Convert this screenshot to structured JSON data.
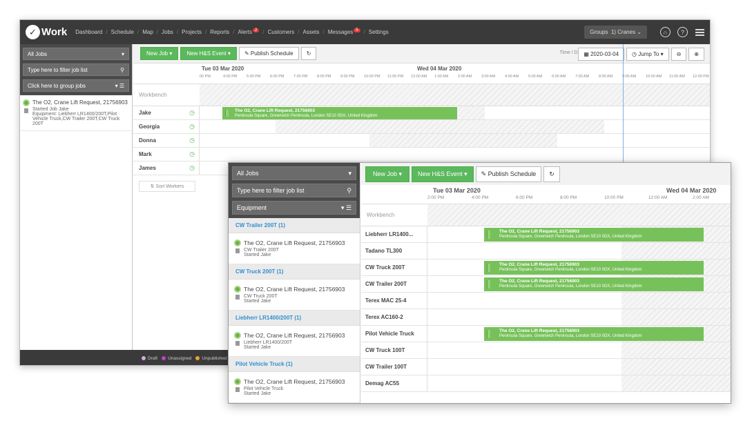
{
  "back": {
    "logo": "Work",
    "nav": [
      {
        "label": "Dashboard"
      },
      {
        "label": "Schedule"
      },
      {
        "label": "Map"
      },
      {
        "label": "Jobs"
      },
      {
        "label": "Projects"
      },
      {
        "label": "Reports"
      },
      {
        "label": "Alerts",
        "badge": "2"
      },
      {
        "label": "Customers"
      },
      {
        "label": "Assets"
      },
      {
        "label": "Messages",
        "badge": "5"
      },
      {
        "label": "Settings"
      }
    ],
    "groups_label": "Groups",
    "groups_value": "1) Cranes",
    "sidebar": {
      "filter_select": "All Jobs",
      "search_placeholder": "Type here to filter job list",
      "group_select": "Click here to group jobs",
      "job": {
        "title": "The O2, Crane Lift Request, 21756903",
        "status": "Started Job Jake",
        "equipment": "Equipment: Liebherr LR1400/200T,Pilot Vehicle Truck,CW Trailer 200T,CW Truck 200T"
      }
    },
    "toolbar": {
      "new_job": "New Job",
      "new_hs": "New H&S Event",
      "publish": "Publish Schedule",
      "range_label": "Time / Date Range",
      "date": "2020-03-04",
      "jump": "Jump To"
    },
    "dates": [
      "Tue 03 Mar 2020",
      "Wed 04 Mar 2020"
    ],
    "times": [
      "00 PM",
      "4:00 PM",
      "5:00 PM",
      "6:00 PM",
      "7:00 PM",
      "8:00 PM",
      "9:00 PM",
      "10:00 PM",
      "11:00 PM",
      "12:00 AM",
      "1:00 AM",
      "2:00 AM",
      "3:00 AM",
      "4:00 AM",
      "5:00 AM",
      "6:00 AM",
      "7:00 AM",
      "8:00 AM",
      "9:00 AM",
      "10:00 AM",
      "11:00 AM",
      "12:00 PM"
    ],
    "workbench": "Workbench",
    "workers": [
      "Jake",
      "Georgia",
      "Donna",
      "Mark",
      "James"
    ],
    "event": {
      "title": "The O2, Crane Lift Request, 21756903",
      "address": "Peninsula Square, Greenwich Peninsula, London SE10 0DX, United Kingdom"
    },
    "sort_workers": "Sort Workers",
    "legend": [
      {
        "label": "Draft",
        "color": "#d9a7e0"
      },
      {
        "label": "Unassigned",
        "color": "#c23fd0"
      },
      {
        "label": "Unpublished",
        "color": "#e8a23a"
      }
    ]
  },
  "front": {
    "sidebar": {
      "filter_select": "All Jobs",
      "search_placeholder": "Type here to filter job list",
      "group_select": "Equipment",
      "groups": [
        {
          "header": "CW Trailer 200T (1)",
          "title": "The O2, Crane Lift Request, 21756903",
          "equipment": "CW Trailer 200T",
          "status": "Started Jake"
        },
        {
          "header": "CW Truck 200T (1)",
          "title": "The O2, Crane Lift Request, 21756903",
          "equipment": "CW Truck 200T",
          "status": "Started Jake"
        },
        {
          "header": "Liebherr LR1400/200T (1)",
          "title": "The O2, Crane Lift Request, 21756903",
          "equipment": "Liebherr LR1400/200T",
          "status": "Started Jake"
        },
        {
          "header": "Pilot Vehicle Truck (1)",
          "title": "The O2, Crane Lift Request, 21756903",
          "equipment": "Pilot Vehicle Truck",
          "status": "Started Jake"
        }
      ]
    },
    "toolbar": {
      "new_job": "New Job",
      "new_hs": "New H&S Event",
      "publish": "Publish Schedule"
    },
    "dates": [
      "Tue 03 Mar 2020",
      "Wed 04 Mar 2020"
    ],
    "times": [
      "2:00 PM",
      "4:00 PM",
      "6:00 PM",
      "8:00 PM",
      "10:00 PM",
      "12:00 AM",
      "2:00 AM"
    ],
    "workbench": "Workbench",
    "equipment": [
      {
        "name": "Liebherr LR1400...",
        "has_event": true
      },
      {
        "name": "Tadano TL300",
        "has_event": false
      },
      {
        "name": "CW Truck 200T",
        "has_event": true
      },
      {
        "name": "CW Trailer 200T",
        "has_event": true
      },
      {
        "name": "Terex MAC 25-4",
        "has_event": false
      },
      {
        "name": "Terex AC160-2",
        "has_event": false
      },
      {
        "name": "Pilot Vehicle Truck",
        "has_event": true
      },
      {
        "name": "CW Truck 100T",
        "has_event": false
      },
      {
        "name": "CW Trailer 100T",
        "has_event": false
      },
      {
        "name": "Demag AC55",
        "has_event": false
      }
    ],
    "event": {
      "title": "The O2, Crane Lift Request, 21756903",
      "address": "Peninsula Square, Greenwich Peninsula, London SE10 0DX, United Kingdom"
    }
  }
}
